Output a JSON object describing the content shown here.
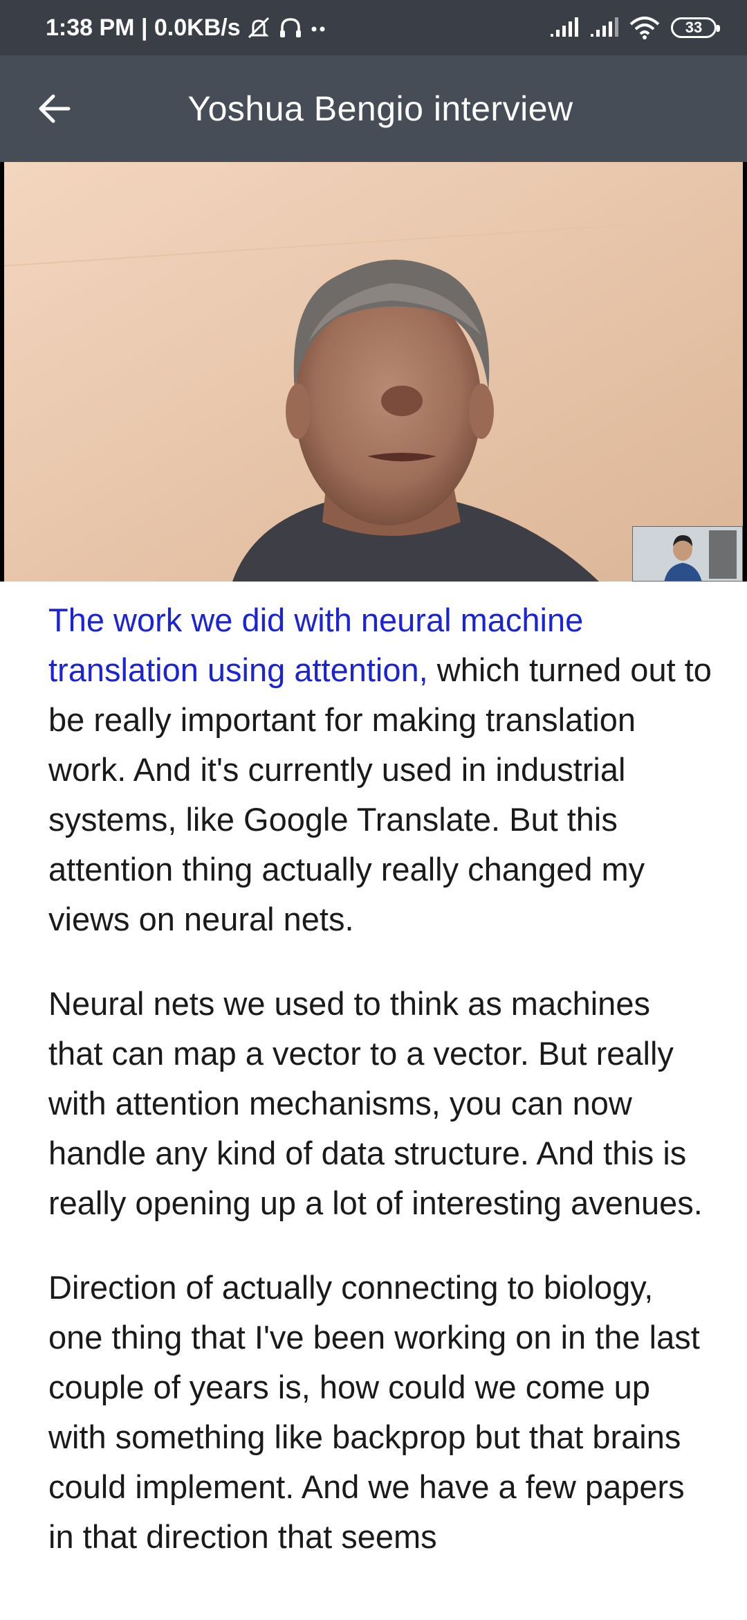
{
  "status_bar": {
    "time_and_speed": "1:38 PM | 0.0KB/s",
    "battery_level": "33",
    "icons": [
      "mute-icon",
      "headphones-icon",
      "more-dots-icon",
      "signal-icon",
      "signal-icon",
      "wifi-icon",
      "battery-icon"
    ]
  },
  "app_bar": {
    "title": "Yoshua Bengio interview",
    "back_icon": "arrow-left-icon"
  },
  "video": {
    "thumbnail_icon": "interviewer-thumbnail"
  },
  "transcript": {
    "para1_highlight": "The work we did with neural machine translation using attention,",
    "para1_rest": " which turned out to be really important for making translation work. And it's currently used in industrial systems, like Google Translate. But this attention thing actually really changed my views on neural nets.",
    "para2": "Neural nets we used to think as machines that can map a vector to a vector. But really with attention mechanisms, you can now handle any kind of data structure. And this is really opening up a lot of interesting avenues.",
    "para3": "Direction of actually connecting to biology, one thing that I've been working on in the last couple of years is, how could we come up with something like backprop but that brains could implement. And we have a few papers in that direction that seems"
  },
  "colors": {
    "highlight": "#1a23d6",
    "app_bar": "#474d56",
    "status_bar": "#3a3f47"
  }
}
